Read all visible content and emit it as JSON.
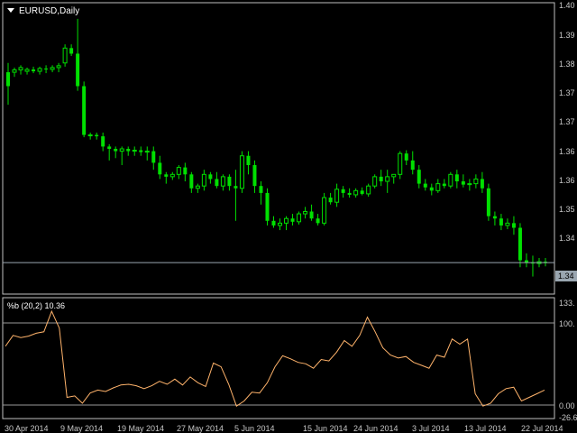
{
  "theme": {
    "background": "#000000",
    "panel_border": "#c0c0c0",
    "candle_color": "#00e000",
    "current_price_line": "#9aa6b0",
    "indicator_color": "#ffb36b",
    "level_line": "#9a9a9a",
    "axis_text": "#c8c8c8"
  },
  "header": {
    "dropdown_icon": "triangle-down-icon",
    "symbol_label": "EURUSD,Daily"
  },
  "price_axis": {
    "labels": [
      "1.40",
      "1.39",
      "1.38",
      "1.37",
      "1.37",
      "1.36",
      "1.36",
      "1.35",
      "1.34"
    ],
    "current_price_label": "1.34"
  },
  "indicator": {
    "title": "%b (20,2) 10.36",
    "axis_labels": [
      "133.",
      "100.",
      "0.00",
      "-26.6"
    ]
  },
  "time_axis": {
    "labels": [
      "30 Apr 2014",
      "9 May 2014",
      "19 May 2014",
      "27 May 2014",
      "5 Jun 2014",
      "15 Jun 2014",
      "24 Jun 2014",
      "3 Jul 2014",
      "13 Jul 2014",
      "22 Jul 2014"
    ]
  },
  "chart_data": [
    {
      "type": "candlestick",
      "title": "EURUSD,Daily",
      "x": [
        "30 Apr 2014",
        "9 May 2014",
        "19 May 2014",
        "27 May 2014",
        "5 Jun 2014",
        "15 Jun 2014",
        "24 Jun 2014",
        "3 Jul 2014",
        "13 Jul 2014",
        "22 Jul 2014"
      ],
      "ylim": [
        1.339,
        1.4
      ],
      "current_price": 1.345,
      "candles": [
        [
          1.386,
          1.388,
          1.379,
          1.383
        ],
        [
          1.386,
          1.387,
          1.385,
          1.3865
        ],
        [
          1.3865,
          1.3875,
          1.3855,
          1.387
        ],
        [
          1.3862,
          1.387,
          1.3855,
          1.3866
        ],
        [
          1.3866,
          1.3872,
          1.3858,
          1.3862
        ],
        [
          1.3862,
          1.3872,
          1.3855,
          1.3868
        ],
        [
          1.3868,
          1.3875,
          1.3858,
          1.3866
        ],
        [
          1.3866,
          1.3875,
          1.386,
          1.387
        ],
        [
          1.387,
          1.388,
          1.386,
          1.3874
        ],
        [
          1.388,
          1.392,
          1.3872,
          1.3912
        ],
        [
          1.3912,
          1.392,
          1.3895,
          1.39
        ],
        [
          1.39,
          1.3975,
          1.382,
          1.383
        ],
        [
          1.383,
          1.384,
          1.372,
          1.3725
        ],
        [
          1.3725,
          1.373,
          1.3715,
          1.3725
        ],
        [
          1.3725,
          1.373,
          1.3715,
          1.3722
        ],
        [
          1.3722,
          1.373,
          1.369,
          1.37
        ],
        [
          1.37,
          1.3705,
          1.367,
          1.3695
        ],
        [
          1.3695,
          1.37,
          1.3675,
          1.369
        ],
        [
          1.369,
          1.37,
          1.366,
          1.3695
        ],
        [
          1.3695,
          1.37,
          1.368,
          1.369
        ],
        [
          1.369,
          1.37,
          1.368,
          1.3692
        ],
        [
          1.3692,
          1.37,
          1.368,
          1.3688
        ],
        [
          1.3688,
          1.37,
          1.367,
          1.369
        ],
        [
          1.369,
          1.37,
          1.365,
          1.3665
        ],
        [
          1.3665,
          1.368,
          1.363,
          1.364
        ],
        [
          1.364,
          1.3645,
          1.362,
          1.3635
        ],
        [
          1.3635,
          1.3645,
          1.3628,
          1.364
        ],
        [
          1.364,
          1.366,
          1.363,
          1.3655
        ],
        [
          1.3655,
          1.3665,
          1.3625,
          1.364
        ],
        [
          1.364,
          1.3645,
          1.36,
          1.361
        ],
        [
          1.361,
          1.362,
          1.36,
          1.3615
        ],
        [
          1.3615,
          1.365,
          1.3605,
          1.364
        ],
        [
          1.364,
          1.3645,
          1.362,
          1.363
        ],
        [
          1.363,
          1.3645,
          1.361,
          1.3615
        ],
        [
          1.3615,
          1.364,
          1.3605,
          1.3635
        ],
        [
          1.3635,
          1.364,
          1.3605,
          1.3615
        ],
        [
          1.3615,
          1.365,
          1.354,
          1.361
        ],
        [
          1.361,
          1.369,
          1.36,
          1.368
        ],
        [
          1.368,
          1.369,
          1.364,
          1.366
        ],
        [
          1.366,
          1.367,
          1.36,
          1.3615
        ],
        [
          1.3615,
          1.3625,
          1.3575,
          1.36
        ],
        [
          1.36,
          1.361,
          1.353,
          1.354
        ],
        [
          1.354,
          1.355,
          1.3525,
          1.353
        ],
        [
          1.353,
          1.3545,
          1.352,
          1.3535
        ],
        [
          1.3535,
          1.355,
          1.352,
          1.3545
        ],
        [
          1.3545,
          1.3555,
          1.353,
          1.3538
        ],
        [
          1.3538,
          1.356,
          1.3532,
          1.3555
        ],
        [
          1.3555,
          1.357,
          1.3545,
          1.356
        ],
        [
          1.356,
          1.3575,
          1.354,
          1.3545
        ],
        [
          1.3545,
          1.3555,
          1.353,
          1.3535
        ],
        [
          1.3535,
          1.36,
          1.353,
          1.359
        ],
        [
          1.359,
          1.36,
          1.3575,
          1.358
        ],
        [
          1.358,
          1.362,
          1.357,
          1.3608
        ],
        [
          1.3608,
          1.3615,
          1.359,
          1.36
        ],
        [
          1.36,
          1.361,
          1.359,
          1.3596
        ],
        [
          1.3596,
          1.361,
          1.359,
          1.3605
        ],
        [
          1.3605,
          1.3612,
          1.3595,
          1.3598
        ],
        [
          1.3598,
          1.362,
          1.3592,
          1.3615
        ],
        [
          1.3615,
          1.364,
          1.361,
          1.3635
        ],
        [
          1.3635,
          1.365,
          1.3615,
          1.3625
        ],
        [
          1.3625,
          1.365,
          1.36,
          1.3635
        ],
        [
          1.3635,
          1.364,
          1.362,
          1.364
        ],
        [
          1.364,
          1.369,
          1.363,
          1.3685
        ],
        [
          1.3685,
          1.3692,
          1.366,
          1.367
        ],
        [
          1.367,
          1.369,
          1.364,
          1.365
        ],
        [
          1.365,
          1.366,
          1.361,
          1.362
        ],
        [
          1.362,
          1.363,
          1.3605,
          1.3612
        ],
        [
          1.3612,
          1.362,
          1.3595,
          1.3605
        ],
        [
          1.3605,
          1.363,
          1.36,
          1.362
        ],
        [
          1.362,
          1.363,
          1.361,
          1.3615
        ],
        [
          1.3615,
          1.3645,
          1.361,
          1.364
        ],
        [
          1.364,
          1.365,
          1.361,
          1.3625
        ],
        [
          1.3625,
          1.364,
          1.3612,
          1.3618
        ],
        [
          1.3618,
          1.363,
          1.3605,
          1.362
        ],
        [
          1.362,
          1.364,
          1.361,
          1.363
        ],
        [
          1.363,
          1.3645,
          1.36,
          1.361
        ],
        [
          1.361,
          1.362,
          1.354,
          1.355
        ],
        [
          1.355,
          1.356,
          1.353,
          1.3545
        ],
        [
          1.3545,
          1.3555,
          1.352,
          1.353
        ],
        [
          1.353,
          1.3545,
          1.3522,
          1.3535
        ],
        [
          1.3535,
          1.355,
          1.351,
          1.3525
        ],
        [
          1.3525,
          1.3535,
          1.344,
          1.3455
        ],
        [
          1.3455,
          1.347,
          1.344,
          1.345
        ],
        [
          1.345,
          1.3465,
          1.342,
          1.3448
        ],
        [
          1.3448,
          1.346,
          1.344,
          1.3452
        ],
        [
          1.3452,
          1.346,
          1.3442,
          1.345
        ]
      ]
    },
    {
      "type": "line",
      "title": "%b (20,2) 10.36",
      "ylim": [
        -26.6,
        133.0
      ],
      "levels": [
        100,
        0
      ],
      "series": [
        {
          "values": [
            70,
            85,
            82,
            84,
            88,
            90,
            118,
            95,
            0,
            2,
            -8,
            6,
            10,
            8,
            13,
            17,
            18,
            16,
            12,
            16,
            22,
            18,
            25,
            17,
            28,
            20,
            15,
            47,
            42,
            18,
            -12,
            -5,
            7,
            6,
            20,
            42,
            57,
            53,
            48,
            46,
            40,
            52,
            50,
            62,
            78,
            70,
            85,
            110,
            90,
            68,
            58,
            54,
            56,
            48,
            44,
            40,
            58,
            55,
            80,
            73,
            80,
            5,
            -12,
            -8,
            5,
            12,
            14,
            -5,
            0,
            5,
            10
          ]
        }
      ]
    }
  ]
}
